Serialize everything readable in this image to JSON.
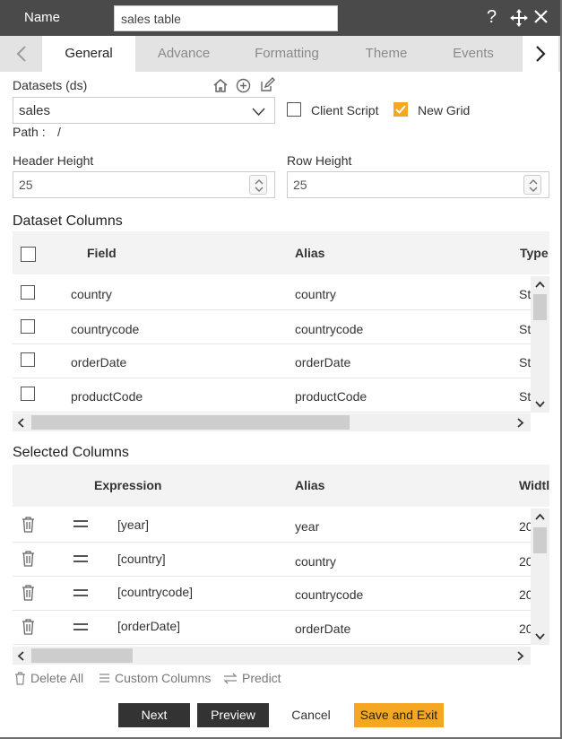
{
  "header": {
    "name_label": "Name",
    "name_value": "sales table"
  },
  "tabs": [
    {
      "label": "General"
    },
    {
      "label": "Advance"
    },
    {
      "label": "Formatting"
    },
    {
      "label": "Theme"
    },
    {
      "label": "Events"
    }
  ],
  "dataset": {
    "label": "Datasets (ds)",
    "selected": "sales",
    "path_label": "Path :",
    "path_value": "/"
  },
  "options": {
    "client_script_label": "Client Script",
    "client_script_checked": false,
    "new_grid_label": "New Grid",
    "new_grid_checked": true
  },
  "heights": {
    "header_label": "Header Height",
    "header_value": "25",
    "row_label": "Row Height",
    "row_value": "25"
  },
  "dataset_columns": {
    "title": "Dataset Columns",
    "headers": {
      "field": "Field",
      "alias": "Alias",
      "type": "Type"
    },
    "rows": [
      {
        "field": "country",
        "alias": "country",
        "type": "St"
      },
      {
        "field": "countrycode",
        "alias": "countrycode",
        "type": "St"
      },
      {
        "field": "orderDate",
        "alias": "orderDate",
        "type": "St"
      },
      {
        "field": "productCode",
        "alias": "productCode",
        "type": "St"
      }
    ]
  },
  "selected_columns": {
    "title": "Selected Columns",
    "headers": {
      "expression": "Expression",
      "alias": "Alias",
      "width": "Widtl"
    },
    "rows": [
      {
        "expression": "[year]",
        "alias": "year",
        "width": "20"
      },
      {
        "expression": "[country]",
        "alias": "country",
        "width": "20"
      },
      {
        "expression": "[countrycode]",
        "alias": "countrycode",
        "width": "20"
      },
      {
        "expression": "[orderDate]",
        "alias": "orderDate",
        "width": "20"
      }
    ]
  },
  "footer_actions": {
    "delete_all": "Delete All",
    "custom_columns": "Custom Columns",
    "predict": "Predict"
  },
  "buttons": {
    "next": "Next",
    "preview": "Preview",
    "cancel": "Cancel",
    "save_exit": "Save and Exit"
  },
  "colors": {
    "accent": "#f5a623",
    "header_bg": "#4a4a4a",
    "tab_bg": "#e3e3e3"
  }
}
